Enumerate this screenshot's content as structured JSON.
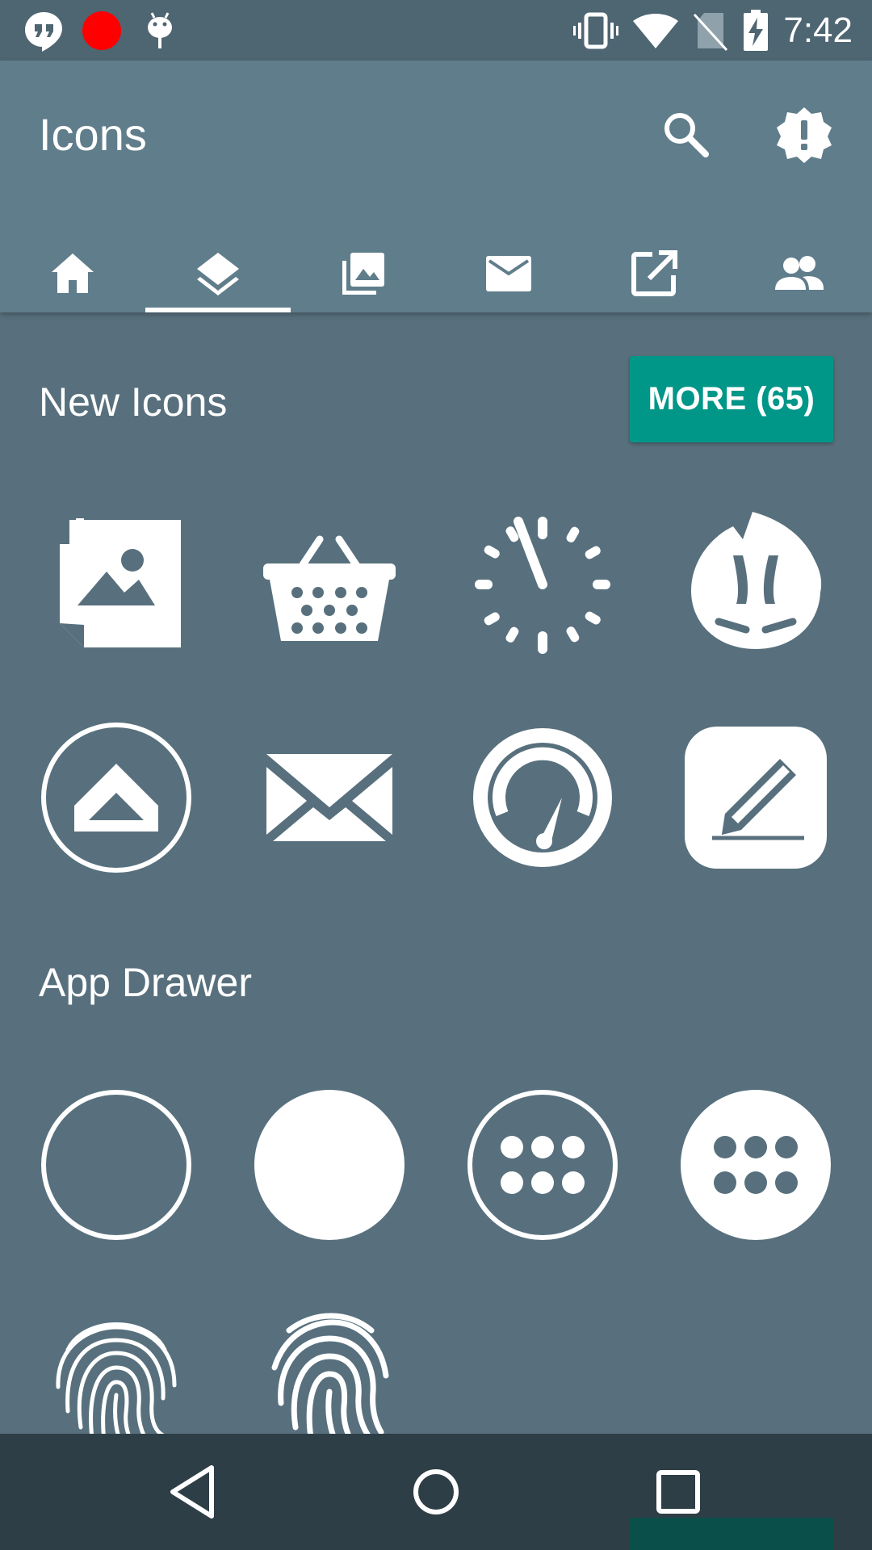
{
  "status_bar": {
    "time": "7:42",
    "left_icons": [
      "hangouts-icon",
      "record-dot-icon",
      "android-debug-icon"
    ],
    "right_icons": [
      "vibrate-icon",
      "wifi-icon",
      "no-sim-icon",
      "battery-charging-icon"
    ],
    "record_color": "#ff0000"
  },
  "app_bar": {
    "title": "Icons",
    "actions": [
      "search-icon",
      "alert-badge-icon"
    ],
    "background": "#607d8b"
  },
  "tabs": {
    "items": [
      {
        "icon": "home-icon",
        "selected": false
      },
      {
        "icon": "layers-icon",
        "selected": true
      },
      {
        "icon": "photo-library-icon",
        "selected": false
      },
      {
        "icon": "mail-icon",
        "selected": false
      },
      {
        "icon": "open-in-new-icon",
        "selected": false
      },
      {
        "icon": "people-icon",
        "selected": false
      }
    ]
  },
  "sections": {
    "new_icons": {
      "title": "New Icons",
      "more_label": "MORE (65)",
      "more_color": "#009688",
      "icons": [
        "sticky-photo-icon",
        "shopping-basket-icon",
        "clock-dots-icon",
        "antutu-icon",
        "arrow-up-circle-icon",
        "envelope-icon",
        "speedometer-icon",
        "edit-pencil-icon"
      ]
    },
    "app_drawer": {
      "title": "App Drawer",
      "icons": [
        "circle-outline-icon",
        "circle-filled-icon",
        "dots-grid-outline-icon",
        "dots-grid-filled-icon",
        "fingerprint-icon",
        "fingerprint-alt-icon"
      ]
    }
  },
  "nav_bar": {
    "buttons": [
      "back-icon",
      "home-circle-icon",
      "recents-icon"
    ],
    "background": "#2e3e46"
  }
}
